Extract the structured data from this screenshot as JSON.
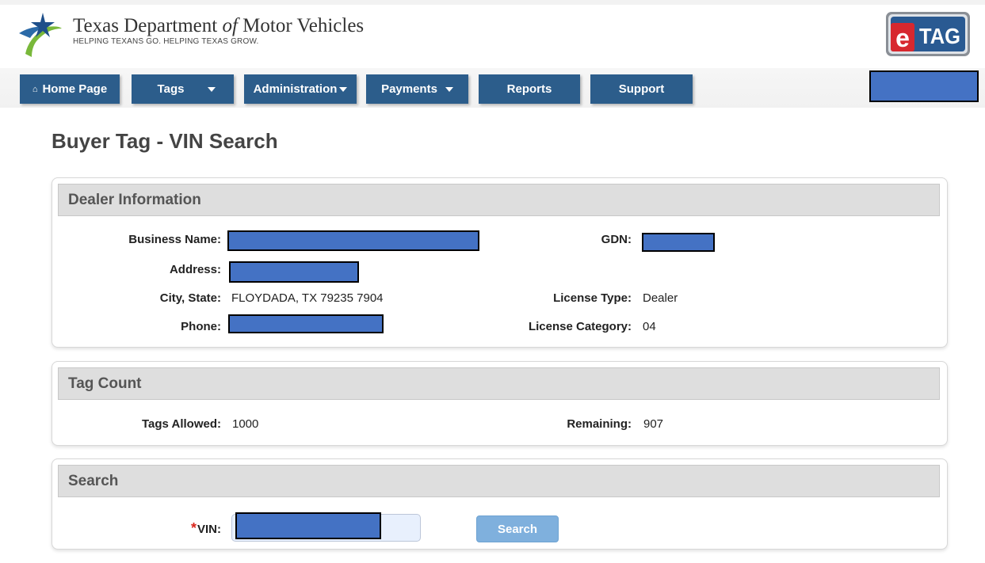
{
  "header": {
    "title_main": "Texas Department ",
    "title_of": "of",
    "title_end": " Motor Vehicles",
    "tagline": "HELPING TEXANS GO. HELPING TEXAS GROW.",
    "etag_e": "e",
    "etag_tag": "TAG",
    "logo_icon": "txdmv-star-swoosh-logo"
  },
  "nav": {
    "home": "Home Page",
    "home_icon": "⌂",
    "tags": "Tags",
    "administration": "Administration",
    "payments": "Payments",
    "reports": "Reports",
    "support": "Support"
  },
  "page": {
    "title": "Buyer Tag - VIN Search"
  },
  "dealer": {
    "heading": "Dealer Information",
    "business_name_label": "Business Name:",
    "gdn_label": "GDN:",
    "address_label": "Address:",
    "city_state_label": "City, State:",
    "city_state_value": "FLOYDADA, TX 79235 7904",
    "license_type_label": "License Type:",
    "license_type_value": "Dealer",
    "phone_label": "Phone:",
    "license_category_label": "License Category:",
    "license_category_value": "04"
  },
  "tag_count": {
    "heading": "Tag Count",
    "allowed_label": "Tags Allowed:",
    "allowed_value": "1000",
    "remaining_label": "Remaining:",
    "remaining_value": "907"
  },
  "search": {
    "heading": "Search",
    "required_mark": "*",
    "vin_label": "VIN:",
    "button": "Search"
  },
  "colors": {
    "nav_bg": "#2c5d8b",
    "redaction": "#4472c4",
    "search_btn": "#7fb0dd",
    "required": "#d9261c"
  }
}
